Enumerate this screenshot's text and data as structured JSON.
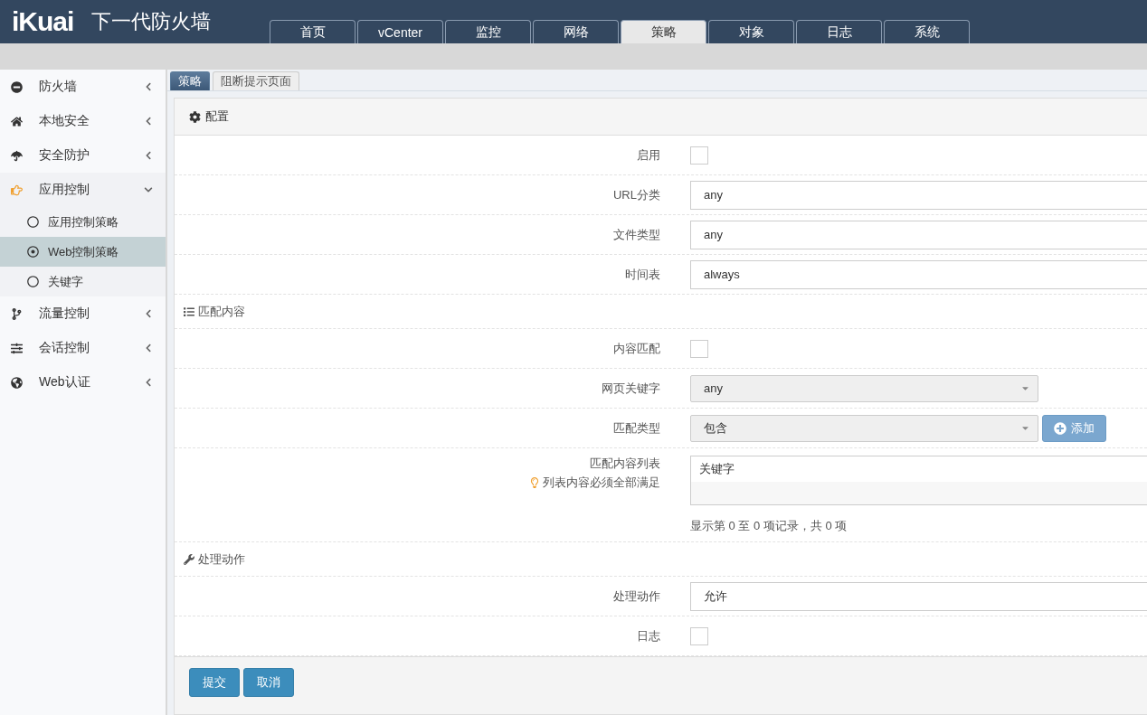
{
  "header": {
    "logo": "iKuai",
    "title": "下一代防火墙"
  },
  "top_tabs": [
    {
      "label": "首页",
      "selected": false
    },
    {
      "label": "vCenter",
      "selected": false
    },
    {
      "label": "监控",
      "selected": false
    },
    {
      "label": "网络",
      "selected": false
    },
    {
      "label": "策略",
      "selected": true
    },
    {
      "label": "对象",
      "selected": false
    },
    {
      "label": "日志",
      "selected": false
    },
    {
      "label": "系统",
      "selected": false
    }
  ],
  "sidebar": {
    "items": [
      {
        "label": "防火墙",
        "expanded": false
      },
      {
        "label": "本地安全",
        "expanded": false
      },
      {
        "label": "安全防护",
        "expanded": false
      },
      {
        "label": "应用控制",
        "expanded": true,
        "children": [
          {
            "label": "应用控制策略",
            "selected": false
          },
          {
            "label": "Web控制策略",
            "selected": true
          },
          {
            "label": "关键字",
            "selected": false
          }
        ]
      },
      {
        "label": "流量控制",
        "expanded": false
      },
      {
        "label": "会话控制",
        "expanded": false
      },
      {
        "label": "Web认证",
        "expanded": false
      }
    ]
  },
  "sub_tabs": [
    {
      "label": "策略",
      "selected": true
    },
    {
      "label": "阻断提示页面",
      "selected": false
    }
  ],
  "panel": {
    "title": "配置",
    "sections": [
      {
        "fields": [
          {
            "kind": "checkbox",
            "label": "启用",
            "checked": false
          },
          {
            "kind": "input",
            "label": "URL分类",
            "value": "any"
          },
          {
            "kind": "input",
            "label": "文件类型",
            "value": "any"
          },
          {
            "kind": "input",
            "label": "时间表",
            "value": "always"
          }
        ]
      },
      {
        "title": "匹配内容",
        "fields": [
          {
            "kind": "checkbox",
            "label": "内容匹配",
            "checked": false
          },
          {
            "kind": "select",
            "label": "网页关键字",
            "value": "any"
          },
          {
            "kind": "select",
            "label": "匹配类型",
            "value": "包含",
            "button": "添加"
          },
          {
            "kind": "list",
            "label": "匹配内容列表",
            "hint": "列表内容必须全部满足",
            "column": "关键字",
            "summary": "显示第 0 至 0 项记录，共 0 项"
          }
        ]
      },
      {
        "title": "处理动作",
        "fields": [
          {
            "kind": "input",
            "label": "处理动作",
            "value": "允许"
          },
          {
            "kind": "checkbox",
            "label": "日志",
            "checked": false
          }
        ]
      }
    ],
    "buttons": [
      "提交",
      "取消"
    ]
  }
}
